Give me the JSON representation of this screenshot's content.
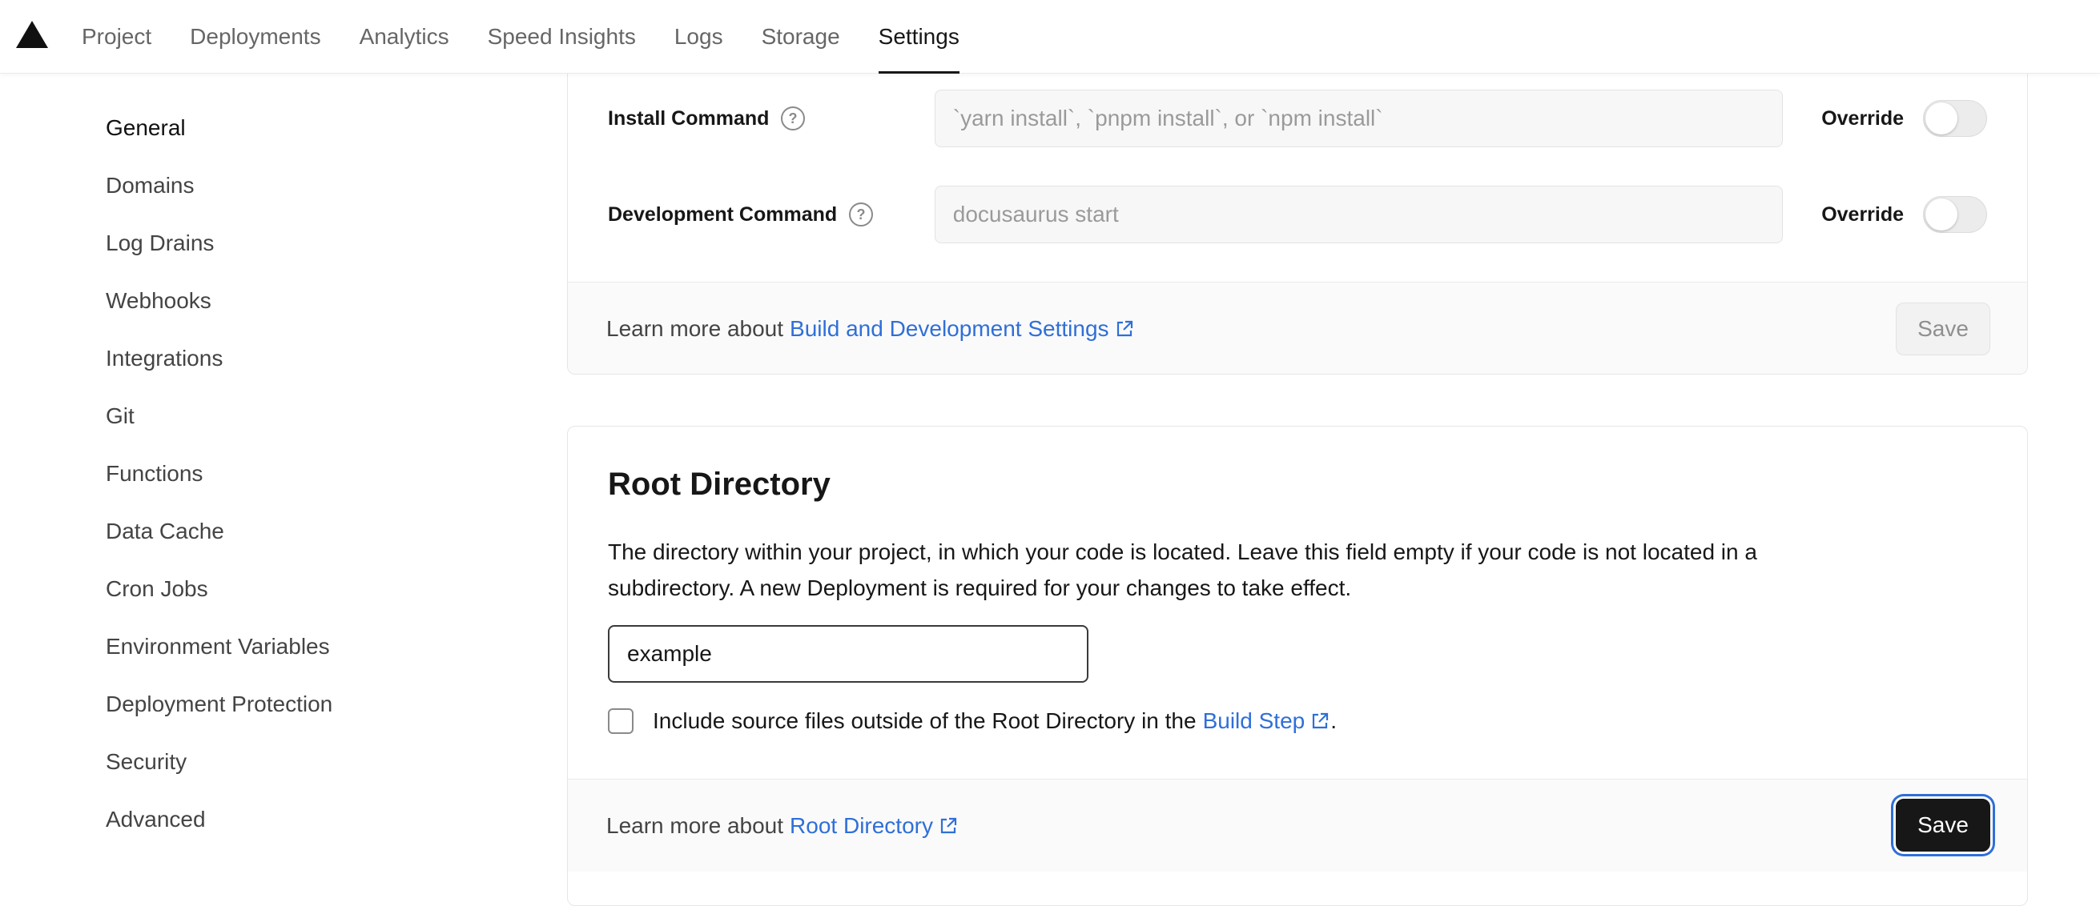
{
  "nav": {
    "logo_icon": "vercel-triangle-icon",
    "tabs": [
      {
        "label": "Project",
        "active": false
      },
      {
        "label": "Deployments",
        "active": false
      },
      {
        "label": "Analytics",
        "active": false
      },
      {
        "label": "Speed Insights",
        "active": false
      },
      {
        "label": "Logs",
        "active": false
      },
      {
        "label": "Storage",
        "active": false
      },
      {
        "label": "Settings",
        "active": true
      }
    ]
  },
  "sidebar": {
    "items": [
      {
        "label": "General",
        "active": true
      },
      {
        "label": "Domains"
      },
      {
        "label": "Log Drains"
      },
      {
        "label": "Webhooks"
      },
      {
        "label": "Integrations"
      },
      {
        "label": "Git"
      },
      {
        "label": "Functions"
      },
      {
        "label": "Data Cache"
      },
      {
        "label": "Cron Jobs"
      },
      {
        "label": "Environment Variables"
      },
      {
        "label": "Deployment Protection"
      },
      {
        "label": "Security"
      },
      {
        "label": "Advanced"
      }
    ]
  },
  "build_settings": {
    "install": {
      "label": "Install Command",
      "placeholder": "`yarn install`, `pnpm install`, or `npm install`",
      "override_label": "Override",
      "override_on": false
    },
    "development": {
      "label": "Development Command",
      "placeholder": "docusaurus start",
      "override_label": "Override",
      "override_on": false
    },
    "footer": {
      "prefix": "Learn more about",
      "link": "Build and Development Settings",
      "save_label": "Save"
    }
  },
  "root_directory": {
    "title": "Root Directory",
    "description": "The directory within your project, in which your code is located. Leave this field empty if your code is not located in a subdirectory. A new Deployment is required for your changes to take effect.",
    "value": "example",
    "checkbox_text": "Include source files outside of the Root Directory in the",
    "checkbox_link": "Build Step",
    "checkbox_suffix": ".",
    "checked": false,
    "footer": {
      "prefix": "Learn more about",
      "link": "Root Directory",
      "save_label": "Save"
    }
  },
  "colors": {
    "accent_link": "#2f6fd8",
    "primary_button": "#171717",
    "focus_ring": "#2f6fd8"
  }
}
